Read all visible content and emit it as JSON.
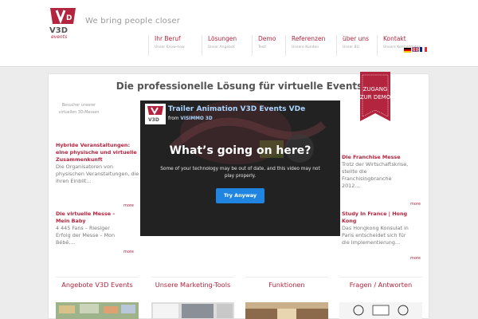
{
  "header": {
    "tagline": "We bring people closer",
    "nav": [
      {
        "label": "Ihr Beruf",
        "sub": "Unser Know-how"
      },
      {
        "label": "Lösungen",
        "sub": "Unser Angebot"
      },
      {
        "label": "Demo",
        "sub": "Test!"
      },
      {
        "label": "Referenzen",
        "sub": "Unsere Kunden"
      },
      {
        "label": "über uns",
        "sub": "Unser BU"
      },
      {
        "label": "Kontakt",
        "sub": "Unsere Kontaktdaten"
      }
    ],
    "flags": [
      "uk-flag-icon",
      "de-flag-icon",
      "fr-flag-icon"
    ]
  },
  "main": {
    "title": "Die professionelle Lösung für virtuelle Events",
    "ribbon": "Zugang zur Demo",
    "side_note": "Besucher unserer virtuellen 3D-Messen",
    "left_posts": [
      {
        "title": "Hybride Veranstaltungen: eine physische und virtuelle Zusammenkunft",
        "body": "Die Organisatoren von physischen Veranstaltungen, die ihren Einblit…",
        "more": "more"
      },
      {
        "title": "Die virtuelle Messe – Mein Baby",
        "body": "4 445 Fans – Riesiger Erfolg der Messe – Mon Bébé,…",
        "more": "more"
      }
    ],
    "right_posts": [
      {
        "title": "Die Franchise Messe",
        "body": "Trotz der Wirtschaftskrise, stellte die Franchisingbranche 2012…",
        "more": "more"
      },
      {
        "title": "Study In France | Hong Kong",
        "body": "Das Hongkong Konsulat in Paris entscheidet sich für die Implementierung…",
        "more": "more"
      }
    ],
    "video": {
      "title": "Trailer Animation V3D Events VDe",
      "from_label": "from",
      "from_name": "VISIMMO 3D",
      "heading": "What’s going on here?",
      "message": "Some of your technology may be out of date, and this video may not play properly.",
      "button": "Try Anyway"
    },
    "cards": [
      {
        "title": "Angebote V3D Events"
      },
      {
        "title": "Unsere Marketing-Tools"
      },
      {
        "title": "Funktionen"
      },
      {
        "title": "Fragen / Antworten"
      }
    ]
  },
  "colors": {
    "accent": "#b3243e",
    "button": "#1f85e0"
  }
}
